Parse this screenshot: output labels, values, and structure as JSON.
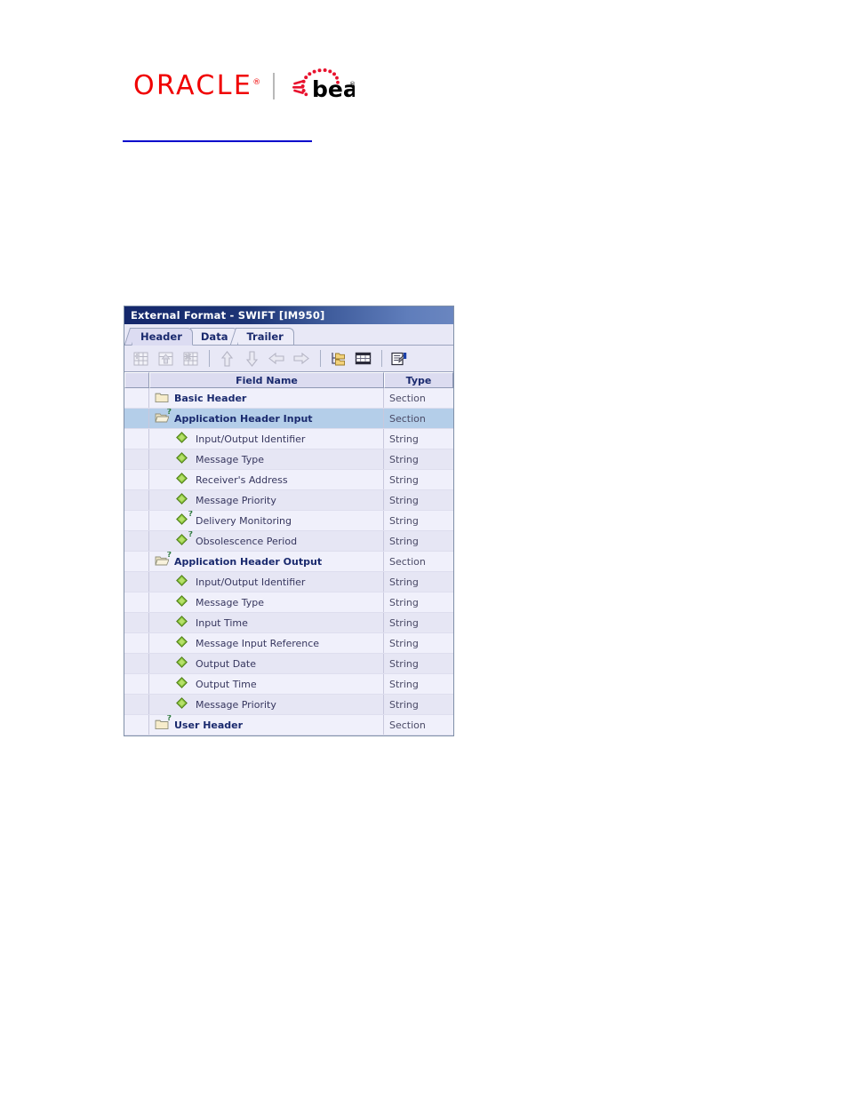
{
  "branding": {
    "oracle_text": "ORACLE",
    "oracle_tm": "®",
    "bea_text": "bea",
    "divider": "|",
    "oracle_color": "#f00000",
    "rule_color": "#0000cc"
  },
  "window": {
    "title": "External Format - SWIFT [IM950]",
    "titlebar_color": "#14276b"
  },
  "tabs": [
    {
      "label": "Header",
      "selected": true
    },
    {
      "label": "Data",
      "selected": false
    },
    {
      "label": "Trailer",
      "selected": false
    }
  ],
  "toolbar": {
    "buttons": [
      {
        "icon": "new-table-icon",
        "name": "new-record-button",
        "enabled": false
      },
      {
        "icon": "copy-table-icon",
        "name": "copy-record-button",
        "enabled": false
      },
      {
        "icon": "delete-table-icon",
        "name": "delete-record-button",
        "enabled": false
      },
      {
        "separator": true
      },
      {
        "icon": "arrow-up-icon",
        "name": "move-up-button",
        "enabled": false
      },
      {
        "icon": "arrow-down-icon",
        "name": "move-down-button",
        "enabled": false
      },
      {
        "icon": "arrow-left-icon",
        "name": "promote-button",
        "enabled": false
      },
      {
        "icon": "arrow-right-icon",
        "name": "demote-button",
        "enabled": false
      },
      {
        "separator": true
      },
      {
        "icon": "folder-tree-icon",
        "name": "tree-view-button",
        "enabled": true
      },
      {
        "icon": "table-grid-icon",
        "name": "grid-view-button",
        "enabled": true
      },
      {
        "separator": true
      },
      {
        "icon": "properties-icon",
        "name": "properties-button",
        "enabled": true
      }
    ]
  },
  "grid": {
    "columns": [
      "",
      "Field Name",
      "Type"
    ],
    "rows": [
      {
        "label": "Basic Header",
        "type": "Section",
        "icon": "folder-closed-icon",
        "optional": false,
        "indent": 0,
        "selected": false,
        "section": true
      },
      {
        "label": "Application Header Input",
        "type": "Section",
        "icon": "folder-open-icon",
        "optional": true,
        "indent": 0,
        "selected": true,
        "section": true
      },
      {
        "label": "Input/Output Identifier",
        "type": "String",
        "icon": "field-diamond-icon",
        "optional": false,
        "indent": 1,
        "selected": false,
        "section": false
      },
      {
        "label": "Message Type",
        "type": "String",
        "icon": "field-diamond-icon",
        "optional": false,
        "indent": 1,
        "selected": false,
        "section": false
      },
      {
        "label": "Receiver's Address",
        "type": "String",
        "icon": "field-diamond-icon",
        "optional": false,
        "indent": 1,
        "selected": false,
        "section": false
      },
      {
        "label": "Message Priority",
        "type": "String",
        "icon": "field-diamond-icon",
        "optional": false,
        "indent": 1,
        "selected": false,
        "section": false
      },
      {
        "label": "Delivery Monitoring",
        "type": "String",
        "icon": "field-diamond-icon",
        "optional": true,
        "indent": 1,
        "selected": false,
        "section": false
      },
      {
        "label": "Obsolescence Period",
        "type": "String",
        "icon": "field-diamond-icon",
        "optional": true,
        "indent": 1,
        "selected": false,
        "section": false
      },
      {
        "label": "Application Header Output",
        "type": "Section",
        "icon": "folder-open-icon",
        "optional": true,
        "indent": 0,
        "selected": false,
        "section": true
      },
      {
        "label": "Input/Output Identifier",
        "type": "String",
        "icon": "field-diamond-icon",
        "optional": false,
        "indent": 1,
        "selected": false,
        "section": false
      },
      {
        "label": "Message Type",
        "type": "String",
        "icon": "field-diamond-icon",
        "optional": false,
        "indent": 1,
        "selected": false,
        "section": false
      },
      {
        "label": "Input Time",
        "type": "String",
        "icon": "field-diamond-icon",
        "optional": false,
        "indent": 1,
        "selected": false,
        "section": false
      },
      {
        "label": "Message Input Reference",
        "type": "String",
        "icon": "field-diamond-icon",
        "optional": false,
        "indent": 1,
        "selected": false,
        "section": false
      },
      {
        "label": "Output Date",
        "type": "String",
        "icon": "field-diamond-icon",
        "optional": false,
        "indent": 1,
        "selected": false,
        "section": false
      },
      {
        "label": "Output Time",
        "type": "String",
        "icon": "field-diamond-icon",
        "optional": false,
        "indent": 1,
        "selected": false,
        "section": false
      },
      {
        "label": "Message Priority",
        "type": "String",
        "icon": "field-diamond-icon",
        "optional": false,
        "indent": 1,
        "selected": false,
        "section": false
      },
      {
        "label": "User Header",
        "type": "Section",
        "icon": "folder-closed-icon",
        "optional": true,
        "indent": 0,
        "selected": false,
        "section": true
      }
    ]
  }
}
